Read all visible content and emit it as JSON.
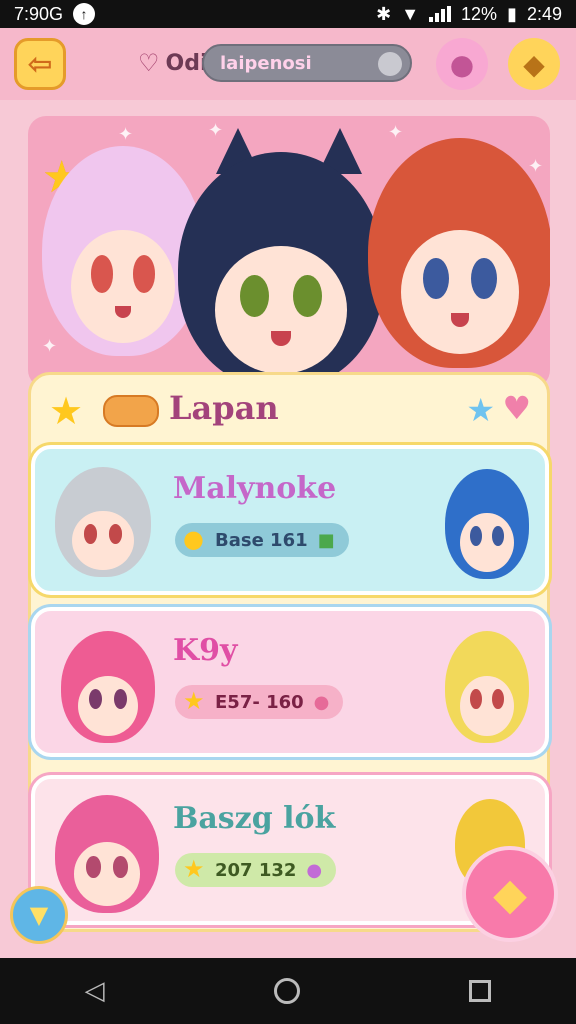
{
  "status": {
    "time": "7:90G",
    "battery": "12%",
    "clock": "2:49"
  },
  "header": {
    "title": "Odie",
    "search_value": "laipenosi"
  },
  "panel": {
    "title": "Lapan"
  },
  "cards": [
    {
      "name": "Malynoke",
      "stat": "Base 161"
    },
    {
      "name": "K9y",
      "stat": "E57- 160"
    },
    {
      "name": "Baszg lók",
      "stat": "207 132"
    }
  ],
  "icons": {
    "back": "left-arrow-icon",
    "heart": "heart-icon",
    "mascot_pink": "pink-creature-icon",
    "mascot_yellow": "yellow-duck-icon",
    "star": "star-icon",
    "fab": "diamond-gem-icon"
  },
  "colors": {
    "background": "#f7c9d6",
    "accent_yellow": "#ffd45a",
    "accent_pink": "#f87aaa"
  }
}
